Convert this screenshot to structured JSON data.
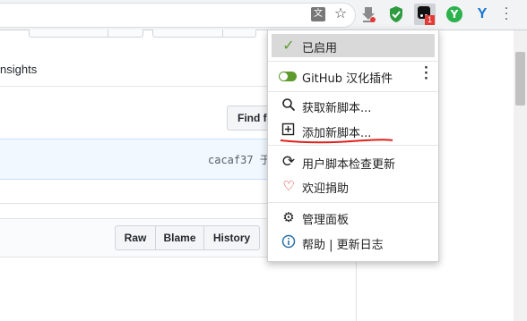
{
  "toolbar": {
    "icons": [
      "translate-icon",
      "star-icon",
      "download-icon",
      "adguard-icon",
      "tampermonkey-icon",
      "extension-green-icon",
      "extension-blue-icon"
    ],
    "badge_count": "1"
  },
  "page": {
    "tab_partial": "nsights",
    "find_file_partial": "Find fi",
    "commit_hash": "cacaf37 于",
    "file_buttons": [
      "Raw",
      "Blame",
      "History"
    ]
  },
  "menu": {
    "enabled_label": "已启用",
    "script_name": "GitHub 汉化插件",
    "get_new_script": "获取新脚本...",
    "add_new_script": "添加新脚本...",
    "check_updates": "用户脚本检查更新",
    "donate": "欢迎捐助",
    "dashboard": "管理面板",
    "help_changelog": "帮助 | 更新日志"
  },
  "colors": {
    "accent_green": "#5f9a2e",
    "highlight": "#d9d9d9",
    "annotation_red": "#e0201a"
  }
}
